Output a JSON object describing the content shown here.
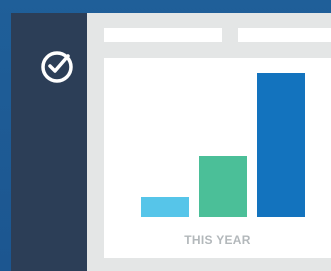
{
  "colors": {
    "background": "#1f5f99",
    "sidebar": "#2c3e57",
    "main": "#e4e6e6",
    "panel": "#ffffff",
    "caption": "#b3b8bb"
  },
  "sidebar": {
    "logo_icon": "checkmark-circle-icon"
  },
  "header": {
    "tabs": [
      "",
      ""
    ]
  },
  "chart_data": {
    "type": "bar",
    "categories": [
      "",
      "",
      ""
    ],
    "values": [
      18,
      54,
      127
    ],
    "colors": [
      "#56c5e9",
      "#4bbf98",
      "#1373be"
    ],
    "title": "",
    "xlabel": "THIS YEAR",
    "ylabel": "",
    "ylim": [
      0,
      140
    ],
    "grid": false
  }
}
